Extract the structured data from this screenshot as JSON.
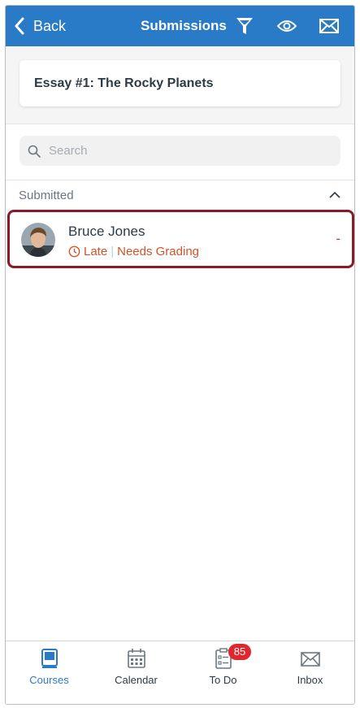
{
  "header": {
    "back_label": "Back",
    "title": "Submissions",
    "color": "#2a7bc7"
  },
  "assignment": {
    "title": "Essay #1: The Rocky Planets"
  },
  "search": {
    "placeholder": "Search"
  },
  "section": {
    "label": "Submitted"
  },
  "submission": {
    "student_name": "Bruce Jones",
    "status_late": "Late",
    "status_grading": "Needs Grading",
    "grade": "-",
    "status_color": "#d0542a",
    "highlight_color": "#8b1a26"
  },
  "tabs": [
    {
      "label": "Courses",
      "icon": "courses-icon",
      "active": true
    },
    {
      "label": "Calendar",
      "icon": "calendar-icon",
      "active": false
    },
    {
      "label": "To Do",
      "icon": "todo-icon",
      "active": false,
      "badge": "85"
    },
    {
      "label": "Inbox",
      "icon": "inbox-icon",
      "active": false
    }
  ]
}
